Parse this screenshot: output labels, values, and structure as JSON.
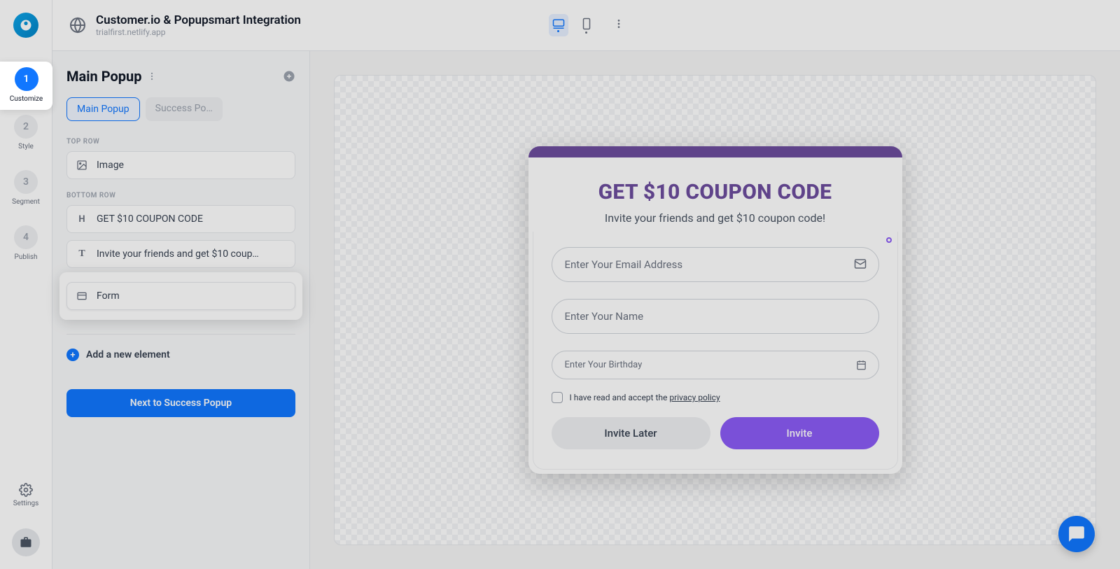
{
  "header": {
    "title": "Customer.io & Popupsmart Integration",
    "subtitle": "trialfirst.netlify.app"
  },
  "rail": {
    "steps": [
      {
        "num": "1",
        "label": "Customize"
      },
      {
        "num": "2",
        "label": "Style"
      },
      {
        "num": "3",
        "label": "Segment"
      },
      {
        "num": "4",
        "label": "Publish"
      }
    ],
    "settings_label": "Settings"
  },
  "panel": {
    "title": "Main Popup",
    "tabs": {
      "active": "Main Popup",
      "inactive": "Success Po…"
    },
    "sections": {
      "top": {
        "label": "TOP ROW",
        "items": [
          {
            "icon": "image",
            "text": "Image"
          }
        ]
      },
      "bottom": {
        "label": "BOTTOM ROW",
        "items": [
          {
            "icon": "H",
            "text": "GET $10 COUPON CODE"
          },
          {
            "icon": "T",
            "text": "Invite your friends and get $10 coup…"
          },
          {
            "icon": "form",
            "text": "Form"
          }
        ]
      }
    },
    "add_label": "Add a new element",
    "next_label": "Next to Success Popup"
  },
  "popup": {
    "headline": "GET $10 COUPON CODE",
    "subhead": "Invite your friends and get $10 coupon code!",
    "fields": {
      "email_placeholder": "Enter Your Email Address",
      "name_placeholder": "Enter Your Name",
      "birthday_placeholder": "Enter Your Birthday"
    },
    "consent_pre": "I have read and accept the ",
    "consent_link": "privacy policy",
    "btn_later": "Invite Later",
    "btn_invite": "Invite"
  }
}
